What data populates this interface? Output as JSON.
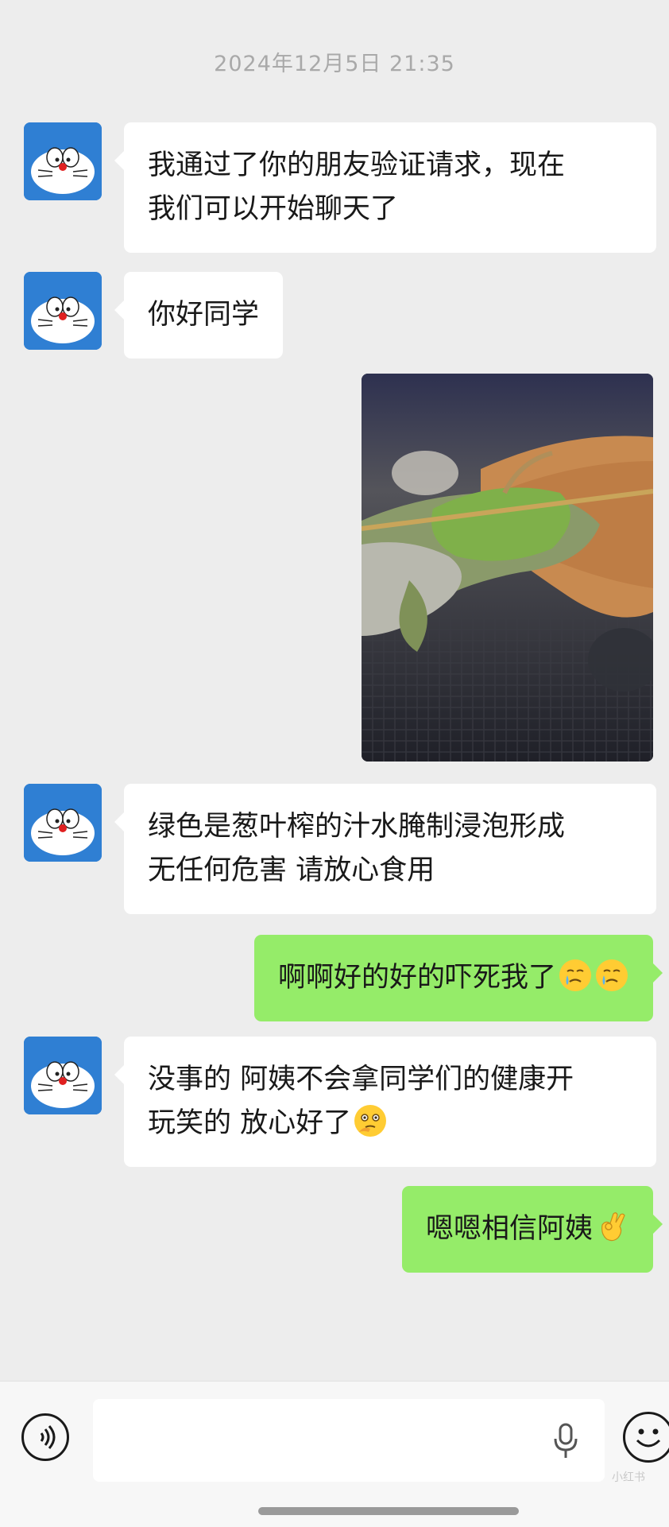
{
  "timestamp": "2024年12月5日 21:35",
  "messages": [
    {
      "sender": "other",
      "lines": [
        "我通过了你的朋友验证请求，现在",
        "我们可以开始聊天了"
      ]
    },
    {
      "sender": "other",
      "lines": [
        "你好同学"
      ]
    },
    {
      "sender": "self",
      "type": "image",
      "image_desc": "photo of skewered meat with greenish scallion coating"
    },
    {
      "sender": "other",
      "lines": [
        "绿色是葱叶榨的汁水腌制浸泡形成",
        "无任何危害 请放心食用"
      ]
    },
    {
      "sender": "self",
      "lines": [
        "啊啊好的好的吓死我了"
      ],
      "emoji": [
        "crying-face-icon",
        "crying-face-icon"
      ]
    },
    {
      "sender": "other",
      "lines": [
        "没事的 阿姨不会拿同学们的健康开",
        "玩笑的 放心好了"
      ],
      "emoji": [
        "thinking-face-icon"
      ]
    },
    {
      "sender": "self",
      "lines": [
        "嗯嗯相信阿姨"
      ],
      "emoji": [
        "ok-hand-icon"
      ]
    }
  ],
  "input": {
    "value": "",
    "placeholder": ""
  },
  "watermark": "小红书",
  "colors": {
    "background": "#ededed",
    "incoming_bubble": "#ffffff",
    "outgoing_bubble": "#95ec69",
    "avatar_bg": "#2f7fd3"
  }
}
